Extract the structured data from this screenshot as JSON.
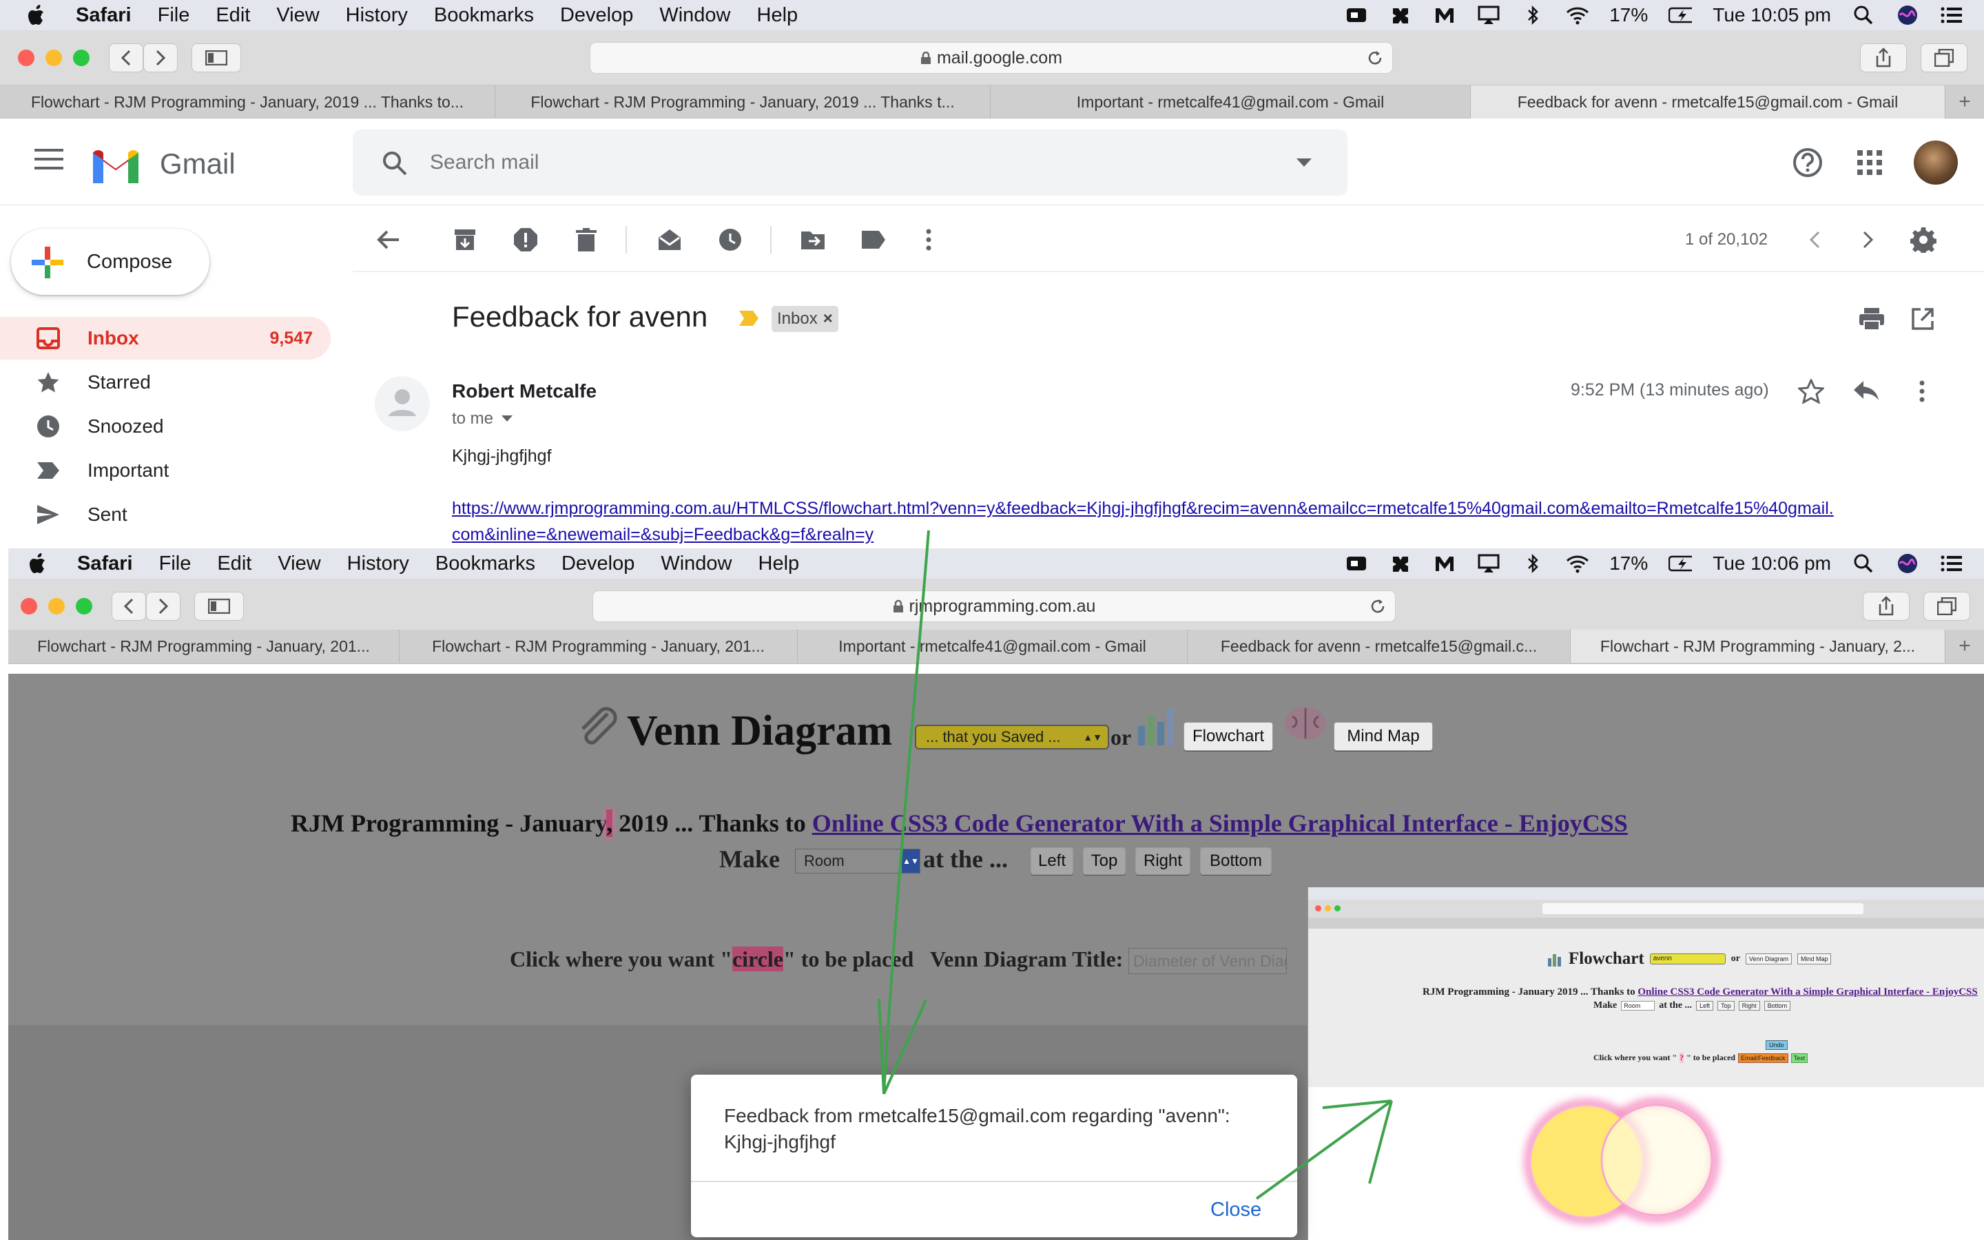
{
  "top": {
    "menubar": {
      "app": "Safari",
      "items": [
        "File",
        "Edit",
        "View",
        "History",
        "Bookmarks",
        "Develop",
        "Window",
        "Help"
      ],
      "battery": "17%",
      "time": "Tue 10:05 pm"
    },
    "url": "mail.google.com",
    "tabs": [
      "Flowchart - RJM Programming - January, 2019 ... Thanks to...",
      "Flowchart - RJM Programming - January, 2019 ... Thanks t...",
      "Important - rmetcalfe41@gmail.com - Gmail",
      "Feedback for avenn - rmetcalfe15@gmail.com - Gmail"
    ],
    "tab_plus": "+"
  },
  "gmail": {
    "brand": "Gmail",
    "search_placeholder": "Search mail",
    "compose": "Compose",
    "sidebar": [
      {
        "label": "Inbox",
        "count": "9,547",
        "icon": "inbox-icon"
      },
      {
        "label": "Starred",
        "icon": "star-icon"
      },
      {
        "label": "Snoozed",
        "icon": "clock-icon"
      },
      {
        "label": "Important",
        "icon": "important-icon"
      },
      {
        "label": "Sent",
        "icon": "send-icon"
      }
    ],
    "pager": "1 of 20,102",
    "subject": "Feedback for avenn",
    "label_chip": "Inbox",
    "label_chip_close": "×",
    "sender": "Robert Metcalfe",
    "to": "to me",
    "time": "9:52 PM (13 minutes ago)",
    "body": "Kjhgj-jhgfjhgf",
    "link_line1": "https://www.rjmprogramming.com.au/HTMLCSS/flowchart.html?venn=y&feedback=Kjhgj-jhgfjhgf&recim=avenn&emailcc=rmetcalfe15%40gmail.com&emailto=Rmetcalfe15%40gmail.",
    "link_line2": "com&inline=&newemail=&subj=Feedback&g=f&realn=y"
  },
  "bottom": {
    "menubar": {
      "app": "Safari",
      "items": [
        "File",
        "Edit",
        "View",
        "History",
        "Bookmarks",
        "Develop",
        "Window",
        "Help"
      ],
      "battery": "17%",
      "time": "Tue 10:06 pm"
    },
    "url": "rjmprogramming.com.au",
    "tabs": [
      "Flowchart - RJM Programming - January, 201...",
      "Flowchart - RJM Programming - January, 201...",
      "Important - rmetcalfe41@gmail.com - Gmail",
      "Feedback for avenn - rmetcalfe15@gmail.c...",
      "Flowchart - RJM Programming - January, 2..."
    ],
    "tab_plus": "+",
    "page_title": "Venn Diagram",
    "select_saved": "... that you Saved ...",
    "or": "or",
    "flowchart_btn": "Flowchart",
    "mindmap_btn": "Mind Map",
    "subtitle_pre": "RJM Programming - January",
    "subtitle_mark": ",",
    "subtitle_mid": " 2019 ... Thanks to ",
    "subtitle_link": "Online CSS3 Code Generator With a Simple Graphical Interface - EnjoyCSS",
    "make": "Make",
    "room_select": "Room",
    "at_the": "at the ...",
    "btn_left": "Left",
    "btn_top": "Top",
    "btn_right": "Right",
    "btn_bottom": "Bottom",
    "click_pre": "Click where you want \"",
    "click_word": "circle",
    "click_post": "\" to be placed",
    "venn_title_label": "Venn Diagram Title:",
    "venn_title_placeholder": "Diameter of Venn Diagram",
    "dialog_line1": "Feedback from rmetcalfe15@gmail.com regarding \"avenn\":",
    "dialog_line2": "Kjhgj-jhgfjhgf",
    "dialog_close": "Close"
  },
  "thumbnail": {
    "title": "Flowchart",
    "select": "avenn",
    "or": "or",
    "btn_venn": "Venn Diagram",
    "btn_mind": "Mind Map",
    "subtitle_pre": "RJM Programming - January",
    "subtitle_mid": " 2019 ... Thanks to ",
    "subtitle_link": "Online CSS3 Code Generator With a Simple Graphical Interface - EnjoyCSS",
    "make": "Make",
    "room": "Room",
    "at_the": "at the ...",
    "btn_left": "Left",
    "btn_top": "Top",
    "btn_right": "Right",
    "btn_bottom": "Bottom",
    "undo": "Undo",
    "click_pre": "Click where you want \"",
    "click_word": "?",
    "click_post": "\" to be placed",
    "email_btn": "Email/Feedback",
    "text_btn": "Text"
  },
  "colors": {
    "gmail_red": "#d93025",
    "link": "#1a0dab",
    "arrow": "#3fa34d",
    "venn_yellow": "#ffe770",
    "venn_pink": "#f58fc4"
  }
}
